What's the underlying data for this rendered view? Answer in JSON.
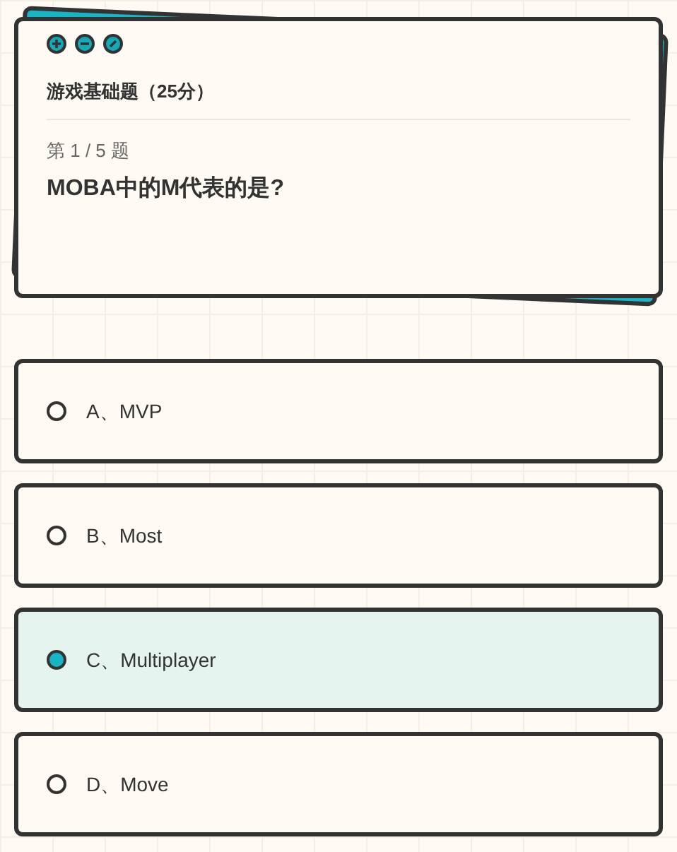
{
  "quiz": {
    "title": "游戏基础题（25分）",
    "progress": "第 1 / 5 题",
    "question": "MOBA中的M代表的是?"
  },
  "options": [
    {
      "label": "A、MVP",
      "selected": false
    },
    {
      "label": "B、Most",
      "selected": false
    },
    {
      "label": "C、Multiplayer",
      "selected": true
    },
    {
      "label": "D、Move",
      "selected": false
    }
  ]
}
